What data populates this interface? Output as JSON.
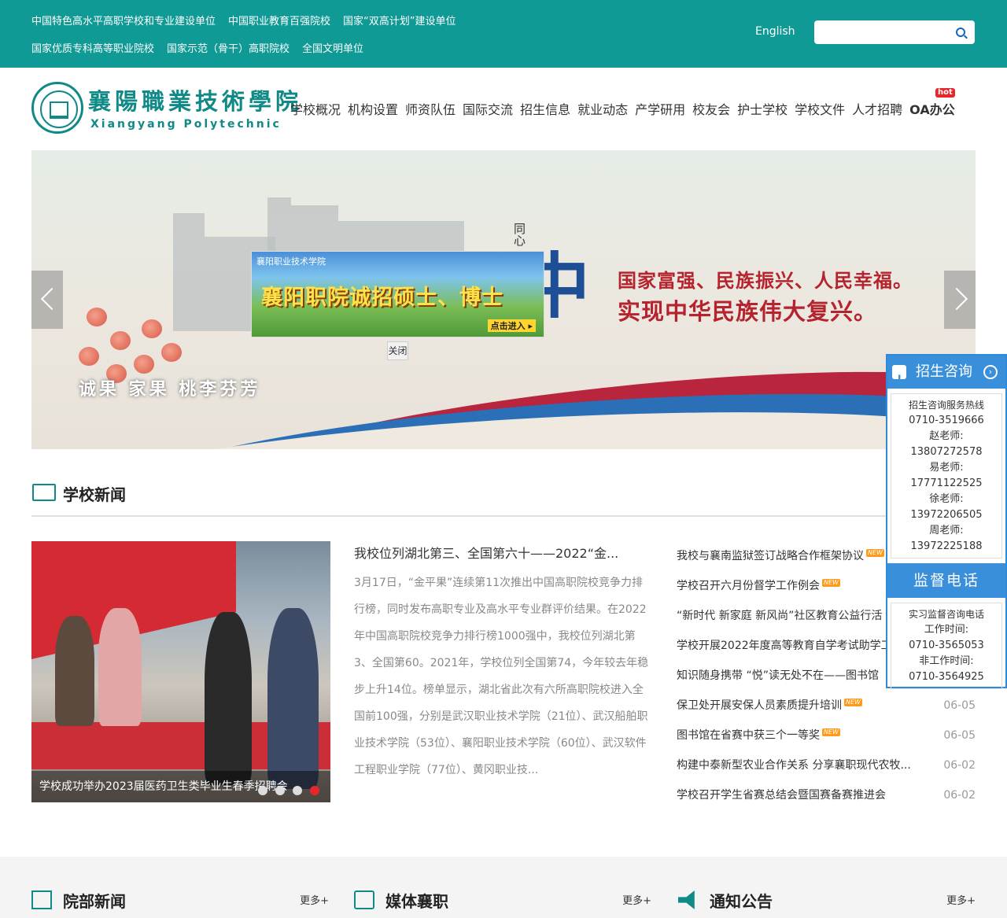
{
  "topbar": {
    "links_row1": [
      "中国特色高水平高职学校和专业建设单位",
      "中国职业教育百强院校",
      "国家“双高计划”建设单位"
    ],
    "links_row2": [
      "国家优质专科高等职业院校",
      "国家示范（骨干）高职院校",
      "全国文明单位"
    ],
    "language": "English",
    "search_placeholder": ""
  },
  "logo": {
    "cn": "襄陽職業技術學院",
    "en": "Xiangyang Polytechnic"
  },
  "nav": {
    "items": [
      "学校概况",
      "机构设置",
      "师资队伍",
      "国际交流",
      "招生信息",
      "就业动态",
      "产学研用",
      "校友会",
      "护士学校",
      "学校文件",
      "人才招聘"
    ],
    "oa_label": "OA办公",
    "hot_badge": "hot"
  },
  "banner": {
    "small_vertical": "同心",
    "dream_char": "中",
    "slogan_line1": "国家富强、民族振兴、人民幸福。",
    "slogan_line2": "实现中华民族伟大复兴。",
    "caption": "诚果  家果  桃李芬芳"
  },
  "popup": {
    "logo_text": "襄阳职业技术学院",
    "title": "襄阳职院诚招硕士、博士",
    "enter_label": "点击进入 ▸",
    "close_label": "关闭"
  },
  "news_section": {
    "title": "学校新闻",
    "photo_caption": "学校成功举办2023届医药卫生类毕业生春季招聘会",
    "slide_count": 4,
    "active_slide": 4,
    "feature_title": "我校位列湖北第三、全国第六十——2022“金...",
    "feature_body": "3月17日，“金平果”连续第11次推出中国高职院校竞争力排行榜，同时发布高职专业及高水平专业群评价结果。在2022年中国高职院校竞争力排行榜1000强中，我校位列湖北第3、全国第60。2021年，学校位列全国第74，今年较去年稳步上升14位。榜单显示，湖北省此次有六所高职院校进入全国前100强，分别是武汉职业技术学院（21位）、武汉船舶职业技术学院（53位）、襄阳职业技术学院（60位）、武汉软件工程职业学院（77位）、黄冈职业技...",
    "items": [
      {
        "title": "我校与襄南监狱签订战略合作框架协议",
        "new": true,
        "date": ""
      },
      {
        "title": "学校召开六月份督学工作例会",
        "new": true,
        "date": ""
      },
      {
        "title": "“新时代 新家庭 新风尚”社区教育公益行活",
        "new": false,
        "date": ""
      },
      {
        "title": "学校开展2022年度高等教育自学考试助学工",
        "new": false,
        "date": ""
      },
      {
        "title": "知识随身携带 “悦”读无处不在——图书馆",
        "new": false,
        "date": ""
      },
      {
        "title": "保卫处开展安保人员素质提升培训",
        "new": true,
        "date": "06-05"
      },
      {
        "title": "图书馆在省赛中获三个一等奖",
        "new": true,
        "date": "06-05"
      },
      {
        "title": "构建中泰新型农业合作关系 分享襄职现代农牧...",
        "new": false,
        "date": "06-02"
      },
      {
        "title": "学校召开学生省赛总结会暨国赛备赛推进会",
        "new": false,
        "date": "06-02"
      }
    ],
    "new_badge": "NEW"
  },
  "bottom_columns": [
    {
      "name": "院部新闻",
      "more": "更多+"
    },
    {
      "name": "媒体襄职",
      "more": "更多+"
    },
    {
      "name": "通知公告",
      "more": "更多+"
    }
  ],
  "side_panel": {
    "head1": "招生咨询",
    "box1": [
      "招生咨询服务热线",
      "0710-3519666",
      "赵老师:",
      "13807272578",
      "易老师:",
      "17771122525",
      "徐老师:",
      "13972206505",
      "周老师:",
      "13972225188"
    ],
    "head2": "监督电话",
    "box2": [
      "实习监督咨询电话",
      "工作时间:",
      "0710-3565053",
      "非工作时间:",
      "0710-3564925"
    ]
  }
}
